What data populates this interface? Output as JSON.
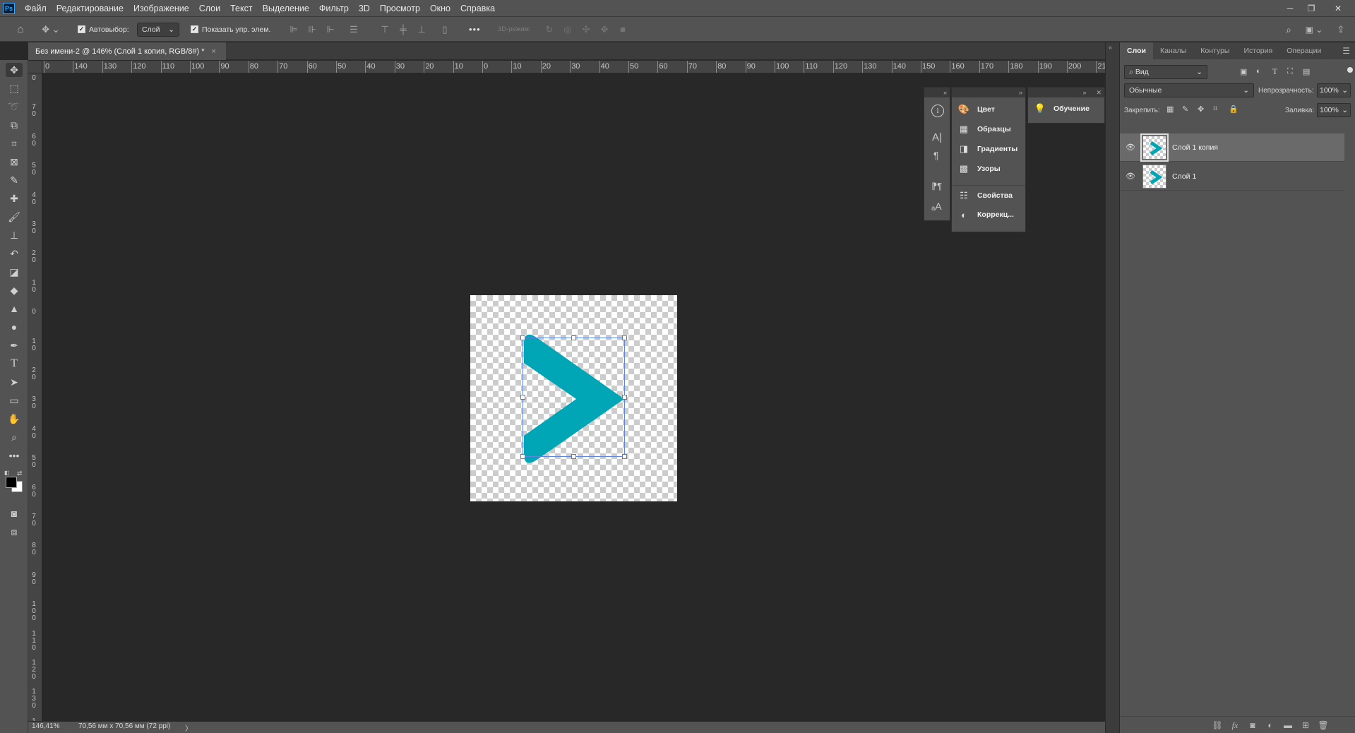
{
  "app": {
    "logo": "Ps"
  },
  "menu": [
    "Файл",
    "Редактирование",
    "Изображение",
    "Слои",
    "Текст",
    "Выделение",
    "Фильтр",
    "3D",
    "Просмотр",
    "Окно",
    "Справка"
  ],
  "options": {
    "autoselect_label": "Автовыбор:",
    "autoselect_checked": true,
    "autoselect_target": "Слой",
    "show_transform_label": "Показать упр. элем.",
    "show_transform_checked": true,
    "mode_3d_label": "3D-режим:",
    "more": "•••"
  },
  "document": {
    "tab_title": "Без имени-2 @ 146% (Слой 1 копия, RGB/8#) *",
    "close": "×"
  },
  "rulers": {
    "horizontal": [
      "0",
      "140",
      "130",
      "120",
      "110",
      "100",
      "90",
      "80",
      "70",
      "60",
      "50",
      "40",
      "30",
      "20",
      "10",
      "0",
      "10",
      "20",
      "30",
      "40",
      "50",
      "60",
      "70",
      "80",
      "90",
      "100",
      "110",
      "120",
      "130",
      "140",
      "150",
      "160",
      "170",
      "180",
      "190",
      "200",
      "210"
    ],
    "vertical": [
      "0",
      "7 0",
      "6 0",
      "5 0",
      "4 0",
      "3 0",
      "2 0",
      "1 0",
      "0",
      "1 0",
      "2 0",
      "3 0",
      "4 0",
      "5 0",
      "6 0",
      "7 0",
      "8 0",
      "9 0",
      "1 0 0",
      "1 1 0",
      "1 2 0",
      "1 3 0",
      "1 4"
    ]
  },
  "canvas": {
    "shape_color": "#00a6b5"
  },
  "status": {
    "zoom": "146,41%",
    "doc_info": "70,56 мм x 70,56 мм (72 ppi)",
    "arrow": "〉"
  },
  "float_panels": {
    "col3_items": [
      {
        "label": "Цвет",
        "icon": "palette-icon"
      },
      {
        "label": "Образцы",
        "icon": "swatches-icon"
      },
      {
        "label": "Градиенты",
        "icon": "gradient-icon"
      },
      {
        "label": "Узоры",
        "icon": "patterns-icon"
      },
      {
        "label": "Свойства",
        "icon": "properties-icon"
      },
      {
        "label": "Коррекц...",
        "icon": "adjustments-icon"
      }
    ],
    "learn_label": "Обучение"
  },
  "layers_panel": {
    "tabs": [
      "Слои",
      "Каналы",
      "Контуры",
      "История",
      "Операции"
    ],
    "filter_label": "Вид",
    "blend_mode": "Обычные",
    "opacity_label": "Непрозрачность:",
    "opacity_value": "100%",
    "lock_label": "Закрепить:",
    "fill_label": "Заливка:",
    "fill_value": "100%",
    "layers": [
      {
        "name": "Слой 1 копия",
        "selected": true,
        "visible": true
      },
      {
        "name": "Слой 1",
        "selected": false,
        "visible": true
      }
    ]
  }
}
